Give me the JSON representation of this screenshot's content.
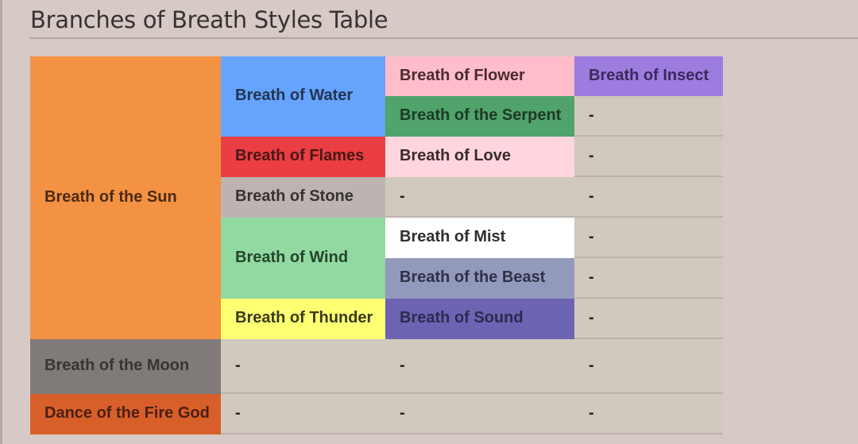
{
  "title": "Branches of Breath Styles Table",
  "colors": {
    "page_bg": "#d5cac6",
    "empty_cell": "#d1c8be"
  },
  "table": {
    "empty_marker": "-",
    "cells": {
      "sun": {
        "label": "Breath of the Sun",
        "bg": "#f49243",
        "fg": "#4a2a14"
      },
      "moon": {
        "label": "Breath of the Moon",
        "bg": "#807a78",
        "fg": "#3a3433"
      },
      "fire_god": {
        "label": "Dance of the Fire God",
        "bg": "#d95f2a",
        "fg": "#4a2010"
      },
      "water": {
        "label": "Breath of Water",
        "bg": "#65a3fd",
        "fg": "#233550"
      },
      "flames": {
        "label": "Breath of Flames",
        "bg": "#ea3e42",
        "fg": "#4a1718"
      },
      "stone": {
        "label": "Breath of Stone",
        "bg": "#bdb4b2",
        "fg": "#363232"
      },
      "wind": {
        "label": "Breath of Wind",
        "bg": "#92d9a1",
        "fg": "#24442c"
      },
      "thunder": {
        "label": "Breath of Thunder",
        "bg": "#ffff73",
        "fg": "#3a3a1a"
      },
      "flower": {
        "label": "Breath of Flower",
        "bg": "#ffbdc9",
        "fg": "#4a2a30"
      },
      "serpent": {
        "label": "Breath of the Serpent",
        "bg": "#50a36b",
        "fg": "#1e3a26"
      },
      "love": {
        "label": "Breath of Love",
        "bg": "#ffd6dd",
        "fg": "#3a2a2e"
      },
      "mist": {
        "label": "Breath of Mist",
        "bg": "#ffffff",
        "fg": "#2e2e2e"
      },
      "beast": {
        "label": "Breath of the Beast",
        "bg": "#9399bb",
        "fg": "#2e3248"
      },
      "sound": {
        "label": "Breath of Sound",
        "bg": "#6c63b2",
        "fg": "#2e2a50"
      },
      "insect": {
        "label": "Breath of Insect",
        "bg": "#9d7ce0",
        "fg": "#3a2a5a"
      }
    }
  }
}
